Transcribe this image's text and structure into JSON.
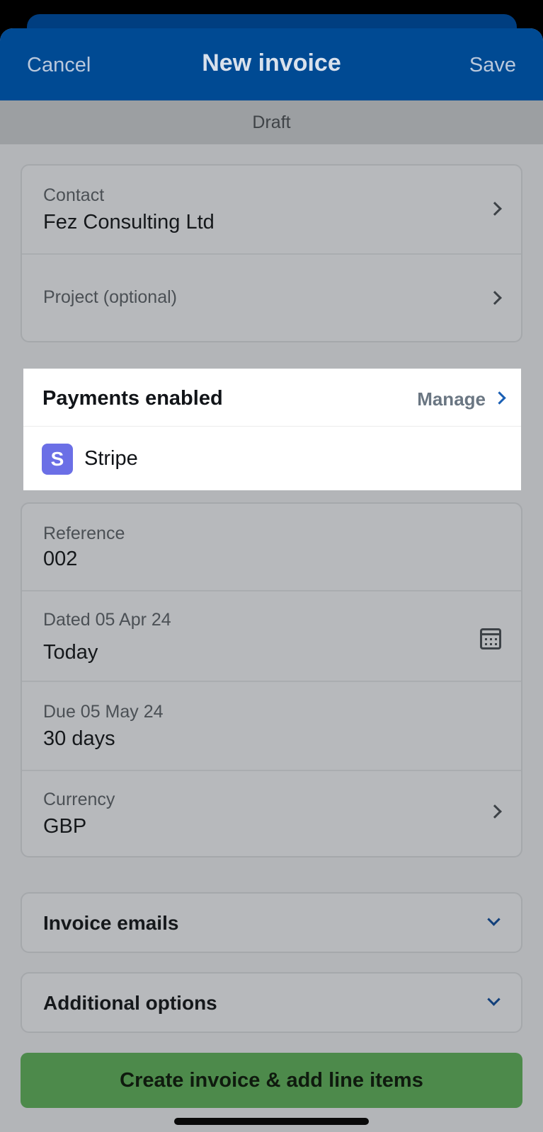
{
  "navbar": {
    "cancel_label": "Cancel",
    "title": "New invoice",
    "save_label": "Save"
  },
  "status": {
    "text": "Draft"
  },
  "contact_card": {
    "contact_label": "Contact",
    "contact_value": "Fez Consulting Ltd",
    "project_label": "Project (optional)"
  },
  "payments": {
    "title": "Payments enabled",
    "manage_label": "Manage",
    "provider_icon_letter": "S",
    "provider_label": "Stripe",
    "provider_color": "#6b6fe6"
  },
  "details_card": {
    "reference_label": "Reference",
    "reference_value": "002",
    "dated_label": "Dated 05 Apr 24",
    "dated_value": "Today",
    "due_label": "Due 05 May 24",
    "due_value": "30 days",
    "currency_label": "Currency",
    "currency_value": "GBP"
  },
  "sections": {
    "invoice_emails": "Invoice emails",
    "additional_options": "Additional options"
  },
  "cta": {
    "label": "Create invoice & add line items",
    "color": "#4d8a4b"
  },
  "colors": {
    "navbar": "#004a93",
    "link": "#1a5fb4"
  }
}
